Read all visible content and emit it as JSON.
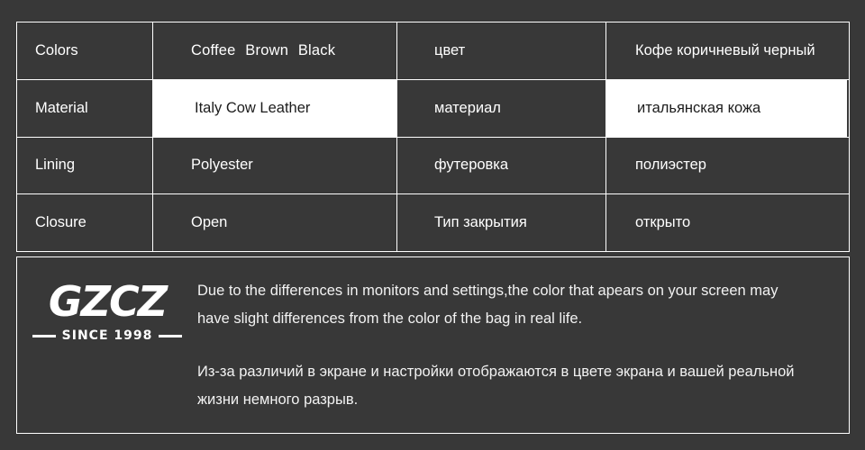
{
  "theme": {
    "background": "#383838",
    "border": "#ffffff",
    "text": "#ffffff",
    "inverted_background": "#ffffff",
    "inverted_text": "#1c1c1c"
  },
  "spec_table": {
    "rows": [
      {
        "label_en": "Colors",
        "value_en": "Coffee  Brown  Black",
        "label_ru": "цвет",
        "value_ru": "Кофе коричневый черный",
        "highlighted": false
      },
      {
        "label_en": "Material",
        "value_en": "Italy Cow Leather",
        "label_ru": "материал",
        "value_ru": "итальянская кожа",
        "highlighted": true
      },
      {
        "label_en": "Lining",
        "value_en": "Polyester",
        "label_ru": "футеровка",
        "value_ru": "полиэстер",
        "highlighted": false
      },
      {
        "label_en": "Closure",
        "value_en": "Open",
        "label_ru": "Тип закрытия",
        "value_ru": "открыто",
        "highlighted": false
      }
    ]
  },
  "disclaimer": {
    "logo": {
      "wordmark": "GZCZ",
      "since": "SINCE 1998"
    },
    "paragraph_en": "Due to the differences in monitors and settings,the color that apears on your screen may have slight differences from the color of the bag in real life.",
    "paragraph_ru": "Из-за различий в экране и настройки отображаются в цвете экрана и вашей реальной жизни немного разрыв."
  }
}
